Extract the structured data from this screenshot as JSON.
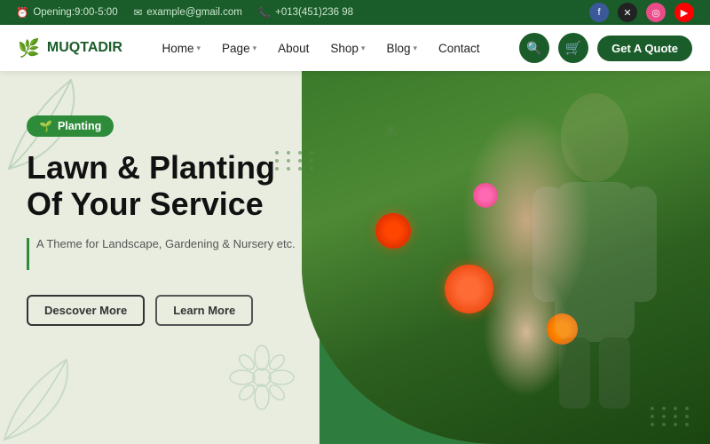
{
  "topbar": {
    "opening": "Opening:9:00-5:00",
    "email": "example@gmail.com",
    "phone": "+013(451)236 98"
  },
  "social": [
    {
      "name": "facebook",
      "label": "f"
    },
    {
      "name": "twitter",
      "label": "✕"
    },
    {
      "name": "dribbble",
      "label": "◎"
    },
    {
      "name": "youtube",
      "label": "▶"
    }
  ],
  "logo": {
    "text": "MUQTADIR",
    "icon": "🌿"
  },
  "nav": {
    "links": [
      {
        "label": "Home",
        "hasDropdown": true
      },
      {
        "label": "Page",
        "hasDropdown": true
      },
      {
        "label": "About",
        "hasDropdown": false
      },
      {
        "label": "Shop",
        "hasDropdown": true
      },
      {
        "label": "Blog",
        "hasDropdown": true
      },
      {
        "label": "Contact",
        "hasDropdown": false
      }
    ],
    "quote_btn": "Get A Quote"
  },
  "hero": {
    "badge": "Planting",
    "badge_icon": "🌱",
    "title_line1": "Lawn & Planting",
    "title_line2": "Of Your Service",
    "subtitle": "A Theme for Landscape, Gardening & Nursery etc.",
    "btn_discover": "Descover More",
    "btn_learn": "Learn More"
  }
}
